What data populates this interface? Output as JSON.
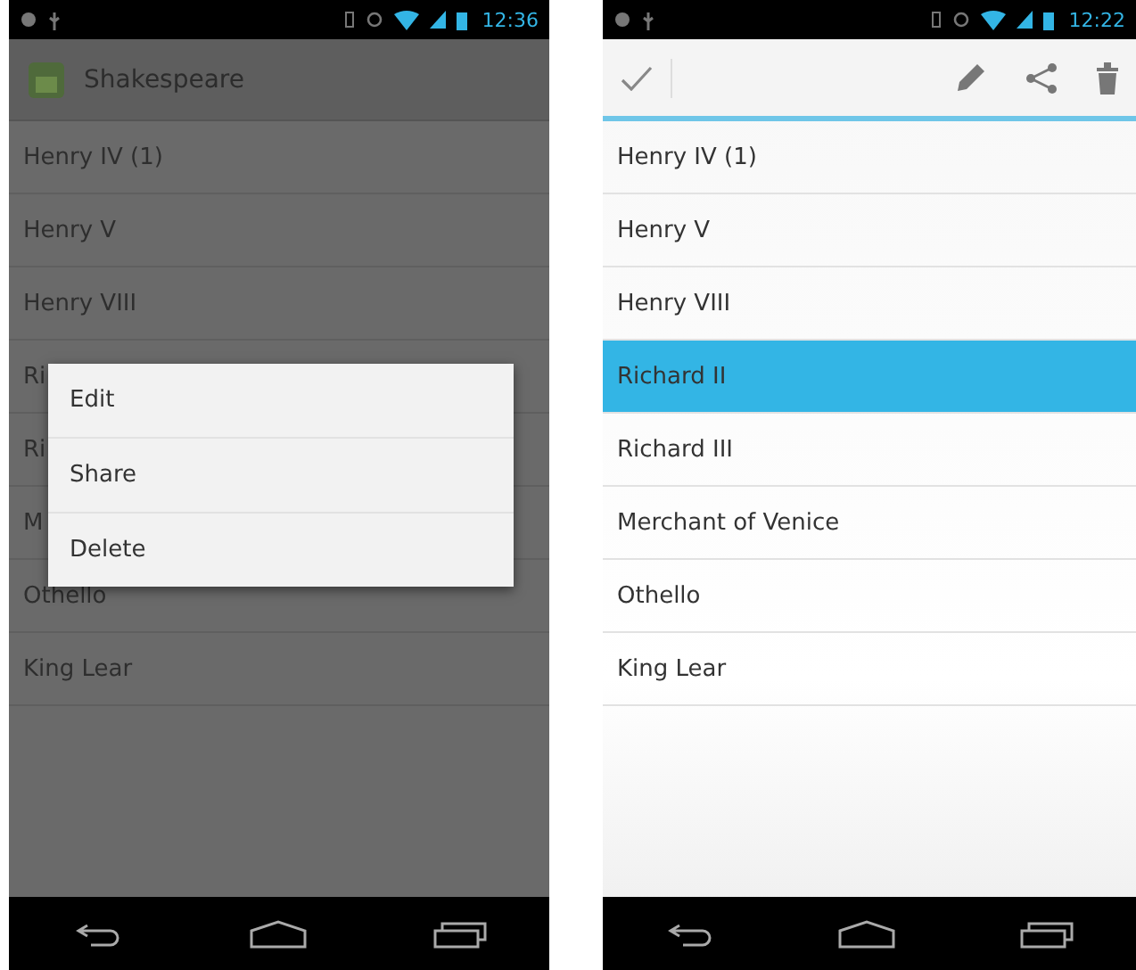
{
  "screens": [
    {
      "kind": "context_menu",
      "status_bar": {
        "time": "12:36"
      },
      "action_bar": {
        "title": "Shakespeare"
      },
      "list": [
        {
          "label": "Henry IV (1)",
          "selected": false
        },
        {
          "label": "Henry V",
          "selected": false
        },
        {
          "label": "Henry VIII",
          "selected": false
        },
        {
          "label": "Ri",
          "selected": false
        },
        {
          "label": "Ri",
          "selected": false
        },
        {
          "label": "M",
          "selected": false
        },
        {
          "label": "Othello",
          "selected": false
        },
        {
          "label": "King Lear",
          "selected": false
        }
      ],
      "menu": [
        {
          "label": "Edit"
        },
        {
          "label": "Share"
        },
        {
          "label": "Delete"
        }
      ]
    },
    {
      "kind": "action_mode",
      "status_bar": {
        "time": "12:22"
      },
      "list": [
        {
          "label": "Henry IV (1)",
          "selected": false
        },
        {
          "label": "Henry V",
          "selected": false
        },
        {
          "label": "Henry VIII",
          "selected": false
        },
        {
          "label": "Richard II",
          "selected": true
        },
        {
          "label": "Richard III",
          "selected": false
        },
        {
          "label": "Merchant of Venice",
          "selected": false
        },
        {
          "label": "Othello",
          "selected": false
        },
        {
          "label": "King Lear",
          "selected": false
        }
      ]
    }
  ]
}
